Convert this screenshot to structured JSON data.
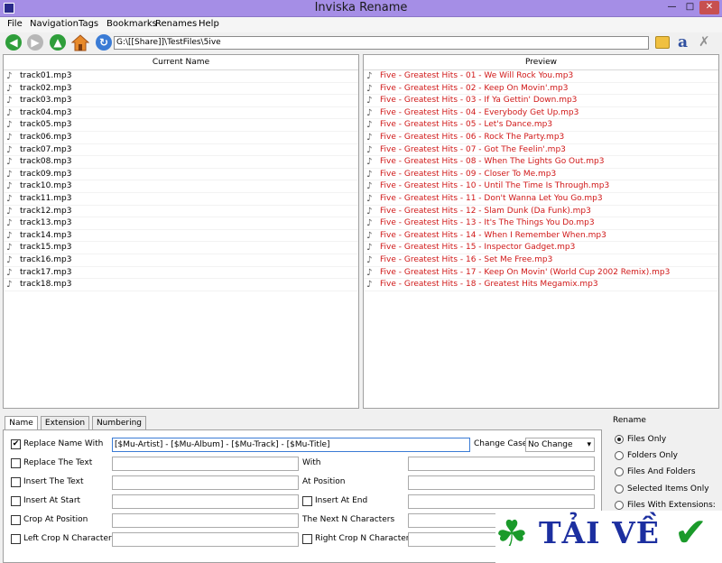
{
  "window": {
    "title": "Inviska Rename",
    "minimize": "—",
    "maximize": "□",
    "close": "✕"
  },
  "menu": [
    "File",
    "Navigation",
    "Tags",
    "Bookmarks",
    "Renames",
    "Help"
  ],
  "toolbar": {
    "path": "G:\\[[Share]]\\TestFiles\\5ive",
    "font_glyph": "a",
    "icons": [
      "back-arrow-icon",
      "forward-arrow-icon",
      "up-arrow-icon",
      "home-icon",
      "refresh-icon",
      "folder-icon",
      "font-icon",
      "tools-icon"
    ]
  },
  "current_panel": {
    "header": "Current Name",
    "files": [
      "track01.mp3",
      "track02.mp3",
      "track03.mp3",
      "track04.mp3",
      "track05.mp3",
      "track06.mp3",
      "track07.mp3",
      "track08.mp3",
      "track09.mp3",
      "track10.mp3",
      "track11.mp3",
      "track12.mp3",
      "track13.mp3",
      "track14.mp3",
      "track15.mp3",
      "track16.mp3",
      "track17.mp3",
      "track18.mp3"
    ]
  },
  "preview_panel": {
    "header": "Preview",
    "color": "#d01818",
    "files": [
      "Five - Greatest Hits - 01 - We Will Rock You.mp3",
      "Five - Greatest Hits - 02 - Keep On Movin'.mp3",
      "Five - Greatest Hits - 03 - If Ya Gettin' Down.mp3",
      "Five - Greatest Hits - 04 - Everybody Get Up.mp3",
      "Five - Greatest Hits - 05 - Let's Dance.mp3",
      "Five - Greatest Hits - 06 - Rock The Party.mp3",
      "Five - Greatest Hits - 07 - Got The Feelin'.mp3",
      "Five - Greatest Hits - 08 - When The Lights Go Out.mp3",
      "Five - Greatest Hits - 09 - Closer To Me.mp3",
      "Five - Greatest Hits - 10 - Until The Time Is Through.mp3",
      "Five - Greatest Hits - 11 - Don't Wanna Let You Go.mp3",
      "Five - Greatest Hits - 12 - Slam Dunk (Da Funk).mp3",
      "Five - Greatest Hits - 13 - It's The Things You Do.mp3",
      "Five - Greatest Hits - 14 - When I Remember When.mp3",
      "Five - Greatest Hits - 15 - Inspector Gadget.mp3",
      "Five - Greatest Hits - 16 - Set Me Free.mp3",
      "Five - Greatest Hits - 17 - Keep On Movin' (World Cup 2002 Remix).mp3",
      "Five - Greatest Hits - 18 - Greatest Hits Megamix.mp3"
    ]
  },
  "tabs": [
    "Name",
    "Extension",
    "Numbering"
  ],
  "name_options": {
    "replace_name": {
      "label": "Replace Name With",
      "checked": true,
      "value": "[$Mu-Artist] - [$Mu-Album] - [$Mu-Track] - [$Mu-Title]"
    },
    "change_case": {
      "label": "Change Case",
      "value": "No Change"
    },
    "replace_text": {
      "label": "Replace The Text",
      "with_label": "With"
    },
    "insert_text": {
      "label": "Insert The Text",
      "at_position_label": "At Position"
    },
    "insert_at_start": {
      "label": "Insert At Start",
      "insert_at_end_label": "Insert At End"
    },
    "crop_at_position": {
      "label": "Crop At Position",
      "next_n_label": "The Next N Characters"
    },
    "left_crop": {
      "label": "Left Crop N Characters",
      "right_crop_label": "Right Crop N Characters"
    }
  },
  "rename_group": {
    "title": "Rename",
    "options": [
      "Files Only",
      "Folders Only",
      "Files And Folders",
      "Selected Items Only",
      "Files With Extensions:"
    ],
    "selected": 0
  },
  "watermark": {
    "text": "TẢI VỀ",
    "brand_color": "#1c2fa0",
    "accent": "#1a9a2a"
  }
}
